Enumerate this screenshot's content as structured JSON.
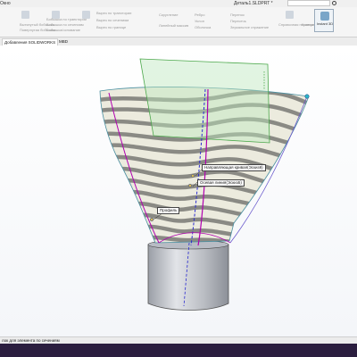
{
  "app": {
    "menu_label": "Окно",
    "document_title": "Деталь1.SLDPRT *"
  },
  "ribbon": {
    "group1": [
      "Вытянутый бобышка",
      "Повернутая бобышка"
    ],
    "group2": [
      "Бобышка по траектории",
      "Бобышка по сечениям",
      "Бобышка/основание"
    ],
    "group3": [
      "Вырез по траектории",
      "Вырез по сечениям",
      "Вырез по границе"
    ],
    "group4": [
      "Скругление",
      "Линейный массив"
    ],
    "group5": [
      "Ребро",
      "Уклон",
      "Оболочка"
    ],
    "group6": [
      "Перенос",
      "Пересечь",
      "Зеркальное отражение"
    ],
    "group7": [
      "Справочная геометрия",
      "Кривые"
    ],
    "instant3d_label": "Instant 3D"
  },
  "tabs": [
    {
      "label": "Добавления SOLIDWORKS"
    },
    {
      "label": "MBD"
    }
  ],
  "callouts": {
    "guide": "Направляющая кривая(Эскиз9)",
    "axis": "Осевая линия(Эскиз5)",
    "profile": "Профиль"
  },
  "status": {
    "hint": "лок для элемента по сечениям"
  }
}
